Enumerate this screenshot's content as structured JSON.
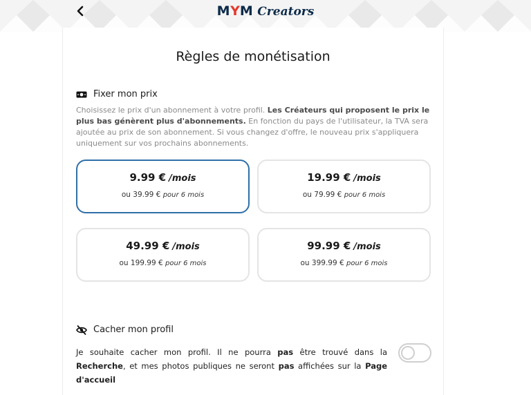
{
  "header": {
    "logo_m1": "M",
    "logo_y": "Y",
    "logo_m2": "M",
    "logo_creators": "Creators"
  },
  "page": {
    "title": "Règles de monétisation"
  },
  "pricing": {
    "title": "Fixer mon prix",
    "description": {
      "part1": "Choisissez le prix d'un abonnement à votre profil. ",
      "bold": "Les Créateurs qui proposent le prix le plus bas génèrent plus d'abonnements.",
      "part2": " En fonction du pays de l'utilisateur, la TVA sera ajoutée au prix de son abonnement. Si vous changez d'offre, le nouveau prix s'appliquera uniquement sur vos prochains abonnements."
    },
    "per_month": "/mois",
    "ou": "ou",
    "six_months": "pour 6 mois",
    "options": [
      {
        "price": "9.99 €",
        "six_month_price": "39.99 €",
        "selected": true
      },
      {
        "price": "19.99 €",
        "six_month_price": "79.99 €",
        "selected": false
      },
      {
        "price": "49.99 €",
        "six_month_price": "199.99 €",
        "selected": false
      },
      {
        "price": "99.99 €",
        "six_month_price": "399.99 €",
        "selected": false
      }
    ]
  },
  "hide_profile": {
    "title": "Cacher mon profil",
    "text": {
      "t1": "Je souhaite cacher mon profil. Il ne pourra ",
      "b1": "pas",
      "t2": " être trouvé dans la ",
      "b2": "Recherche",
      "t3": ", et mes photos publiques ne seront ",
      "b3": "pas",
      "t4": " affichées sur la ",
      "b4": "Page d'accueil"
    },
    "toggle_on": false
  },
  "icons": {
    "back": "chevron-left-icon",
    "price": "banknote-icon",
    "hide": "eye-slash-icon"
  },
  "colors": {
    "selected_border": "#2f6fa8",
    "brand_dark": "#0d2b4a",
    "brand_red": "#e33a2e"
  }
}
